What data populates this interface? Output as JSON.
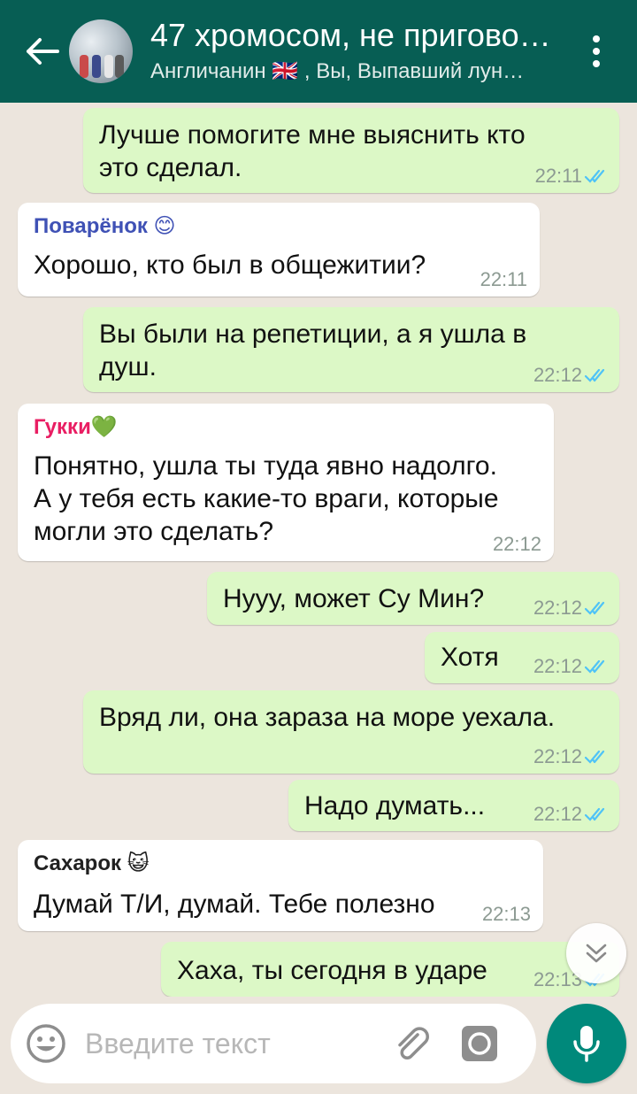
{
  "header": {
    "title": "47 хромосом, не пригово…",
    "subtitle": "Англичанин 🇬🇧 , Вы, Выпавший лун…"
  },
  "messages": [
    {
      "type": "out",
      "text": [
        "Лучше помогите мне выяснить кто",
        "это сделал."
      ],
      "time": "22:11"
    },
    {
      "type": "in",
      "sender": "Поварёнок 😊",
      "sender_color": "#3f51b5",
      "text": [
        "Хорошо, кто был в общежитии?"
      ],
      "time": "22:11"
    },
    {
      "type": "out",
      "text": [
        "Вы были на репетиции, а я ушла в",
        "душ."
      ],
      "time": "22:12"
    },
    {
      "type": "in",
      "sender": "Гукки💚",
      "sender_color": "#e91e63",
      "text": [
        "Понятно, ушла ты туда явно надолго.",
        "А у тебя есть какие-то враги, которые",
        "могли это сделать?"
      ],
      "time": "22:12"
    },
    {
      "type": "out",
      "text": [
        "Нууу, может Су Мин?"
      ],
      "time": "22:12"
    },
    {
      "type": "out",
      "text": [
        "Хотя"
      ],
      "time": "22:12"
    },
    {
      "type": "out",
      "text": [
        "Вряд ли, она зараза на море уехала."
      ],
      "time": "22:12"
    },
    {
      "type": "out",
      "text": [
        "Надо думать..."
      ],
      "time": "22:12"
    },
    {
      "type": "in",
      "sender": "Сахарок 😺",
      "sender_color": "#212121",
      "text": [
        "Думай Т/И, думай. Тебе полезно"
      ],
      "time": "22:13"
    },
    {
      "type": "out",
      "text": [
        "Хаха, ты сегодня в ударе"
      ],
      "time": "22:13"
    }
  ],
  "input": {
    "placeholder": "Введите текст",
    "value": ""
  },
  "colors": {
    "header": "#075e54",
    "outgoing": "#dcf8c6",
    "incoming": "#ffffff",
    "tick": "#4fc3f7",
    "mic": "#00897b"
  },
  "icons": [
    "back-arrow-icon",
    "menu-icon",
    "emoji-icon",
    "attach-icon",
    "camera-icon",
    "mic-icon",
    "scroll-down-icon",
    "double-check-icon"
  ]
}
